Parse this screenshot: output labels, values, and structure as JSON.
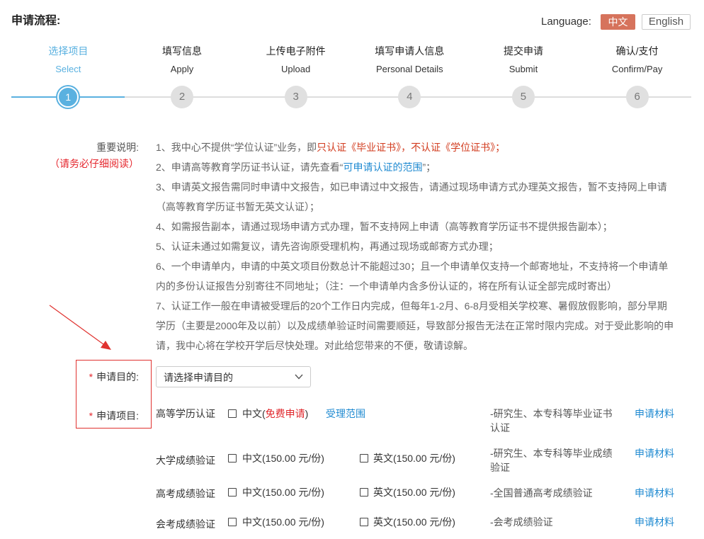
{
  "header": {
    "title": "申请流程:",
    "language_label": "Language:",
    "lang_zh": "中文",
    "lang_en": "English"
  },
  "current_step": 1,
  "steps": [
    {
      "num": "1",
      "zh": "选择项目",
      "en": "Select"
    },
    {
      "num": "2",
      "zh": "填写信息",
      "en": "Apply"
    },
    {
      "num": "3",
      "zh": "上传电子附件",
      "en": "Upload"
    },
    {
      "num": "4",
      "zh": "填写申请人信息",
      "en": "Personal Details"
    },
    {
      "num": "5",
      "zh": "提交申请",
      "en": "Submit"
    },
    {
      "num": "6",
      "zh": "确认/支付",
      "en": "Confirm/Pay"
    }
  ],
  "notes": {
    "label": "重要说明:",
    "warning": "（请务必仔细阅读）",
    "items": [
      {
        "text": "1、我中心不提供“学位认证”业务，即",
        "highlight": "只认证《毕业证书》，不认证《学位证书》；"
      },
      {
        "text": "2、申请高等教育学历证书认证，请先查看“",
        "link": "可申请认证的范围",
        "text_after": "”；"
      },
      {
        "text": "3、申请英文报告需同时申请中文报告，如已申请过中文报告，请通过现场申请方式办理英文报告，暂不支持网上申请（高等教育学历证书暂无英文认证）；"
      },
      {
        "text": "4、如需报告副本，请通过现场申请方式办理，暂不支持网上申请（高等教育学历证书不提供报告副本）；"
      },
      {
        "text": "5、认证未通过如需复议，请先咨询原受理机构，再通过现场或邮寄方式办理；"
      },
      {
        "text": "6、一个申请单内，申请的中英文项目份数总计不能超过30；且一个申请单仅支持一个邮寄地址，不支持将一个申请单内的多份认证报告分别寄往不同地址；（注：一个申请单内含多份认证的，将在所有认证全部完成时寄出）"
      },
      {
        "text": "7、认证工作一般在申请被受理后的20个工作日内完成，但每年1-2月、6-8月受相关学校寒、暑假放假影响，部分早期学历（主要是2000年及以前）以及成绩单验证时间需要顺延，导致部分报告无法在正常时限内完成。对于受此影响的申请，我中心将在学校开学后尽快处理。对此给您带来的不便，敬请谅解。"
      }
    ]
  },
  "form": {
    "purpose": {
      "mark": "*",
      "label": "申请目的:",
      "placeholder": "请选择申请目的"
    },
    "project": {
      "mark": "*",
      "label": "申请项目:"
    },
    "rows": [
      {
        "name": "高等学历认证",
        "zh_prefix": "中文(",
        "zh_free": "免费申请",
        "zh_suffix": ")",
        "scope_link": "受理范围",
        "desc": "-研究生、本专科等毕业证书认证",
        "materials_link": "申请材料"
      },
      {
        "name": "大学成绩验证",
        "zh_option": "中文(150.00 元/份)",
        "en_option": "英文(150.00 元/份)",
        "desc": "-研究生、本专科等毕业成绩验证",
        "materials_link": "申请材料"
      },
      {
        "name": "高考成绩验证",
        "zh_option": "中文(150.00 元/份)",
        "en_option": "英文(150.00 元/份)",
        "desc": "-全国普通高考成绩验证",
        "materials_link": "申请材料"
      },
      {
        "name": "会考成绩验证",
        "zh_option": "中文(150.00 元/份)",
        "en_option": "英文(150.00 元/份)",
        "desc": "-会考成绩验证",
        "materials_link": "申请材料"
      }
    ]
  },
  "colors": {
    "step_active": "#5ab1e0",
    "lang_active_bg": "#d6735c",
    "required_red": "#e5262d",
    "note_highlight": "#d23c1f",
    "link_blue": "#1f8ad1",
    "annotation_red": "#e0322f"
  },
  "icons": {
    "select_chevron": "chevron-down-icon",
    "annotation": "arrow-icon"
  }
}
